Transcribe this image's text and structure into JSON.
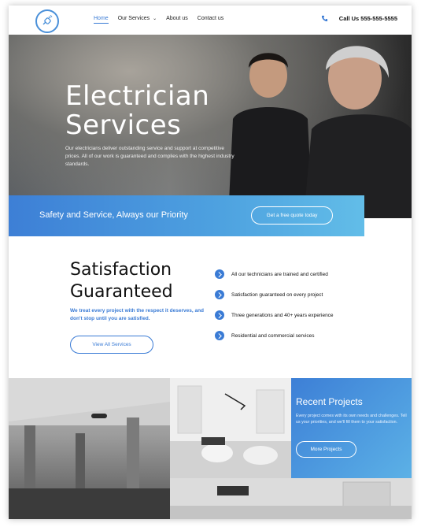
{
  "nav": {
    "items": [
      {
        "label": "Home",
        "active": true
      },
      {
        "label": "Our Services",
        "dropdown": true
      },
      {
        "label": "About us"
      },
      {
        "label": "Contact us"
      }
    ],
    "phone": "Call Us 555-555-5555"
  },
  "hero": {
    "title_line1": "Electrician",
    "title_line2": "Services",
    "text": "Our electricians deliver outstanding service and support at competitive prices. All of our work is guaranteed and complies with the highest industry standards."
  },
  "banner": {
    "text": "Safety and Service, Always our Priority",
    "button": "Get a free quote today"
  },
  "satisfaction": {
    "title_line1": "Satisfaction",
    "title_line2": "Guaranteed",
    "subtitle": "We treat every project with the respect it deserves, and don't stop until you are satisfied.",
    "button": "View All Services",
    "features": [
      "All our technicians are trained and certified",
      "Satisfaction guaranteed on every project",
      "Three generations and 40+ years experience",
      "Residential and commercial services"
    ]
  },
  "projects": {
    "title": "Recent Projects",
    "text": "Every project comes with its own needs and challenges. Tell us your priorities, and we'll fill them to your satisfaction.",
    "button": "More Projects"
  },
  "colors": {
    "accent": "#3a7bd5",
    "banner_gradient_start": "#3d7fd6",
    "banner_gradient_end": "#62bde8"
  }
}
